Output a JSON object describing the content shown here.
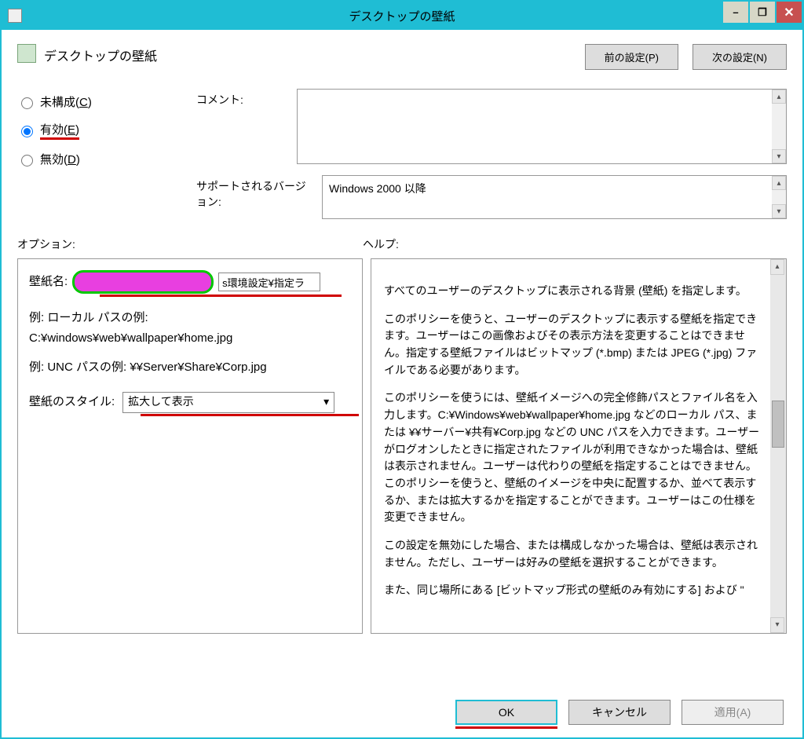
{
  "window": {
    "title": "デスクトップの壁紙",
    "min_label": "–",
    "max_label": "❐",
    "close_label": "✕"
  },
  "header": {
    "policy_name": "デスクトップの壁紙",
    "prev_btn": "前の設定(P)",
    "next_btn": "次の設定(N)"
  },
  "state": {
    "not_configured": {
      "label_head": "未構成(",
      "accel": "C",
      "label_tail": ")"
    },
    "enabled": {
      "label_head": "有効(",
      "accel": "E",
      "label_tail": ")"
    },
    "disabled": {
      "label_head": "無効(",
      "accel": "D",
      "label_tail": ")"
    },
    "selected": "enabled"
  },
  "form": {
    "comment_label": "コメント:",
    "supported_label": "サポートされるバージョン:",
    "supported_value": "Windows 2000 以降"
  },
  "sections": {
    "options_label": "オプション:",
    "help_label": "ヘルプ:"
  },
  "options": {
    "wallpaper_name_label": "壁紙名:",
    "wallpaper_name_value": "s環境設定¥指定ラ",
    "local_example_label": "例: ローカル パスの例:",
    "local_example_value": "C:¥windows¥web¥wallpaper¥home.jpg",
    "unc_example_label": "例: UNC パスの例: ¥¥Server¥Share¥Corp.jpg",
    "style_label": "壁紙のスタイル:",
    "style_value": "拡大して表示"
  },
  "help": {
    "p1": "すべてのユーザーのデスクトップに表示される背景 (壁紙) を指定します。",
    "p2": "このポリシーを使うと、ユーザーのデスクトップに表示する壁紙を指定できます。ユーザーはこの画像およびその表示方法を変更することはできません。指定する壁紙ファイルはビットマップ (*.bmp) または JPEG (*.jpg) ファイルである必要があります。",
    "p3": "このポリシーを使うには、壁紙イメージへの完全修飾パスとファイル名を入力します。C:¥Windows¥web¥wallpaper¥home.jpg などのローカル パス、または ¥¥サーバー¥共有¥Corp.jpg などの UNC パスを入力できます。ユーザーがログオンしたときに指定されたファイルが利用できなかった場合は、壁紙は表示されません。ユーザーは代わりの壁紙を指定することはできません。このポリシーを使うと、壁紙のイメージを中央に配置するか、並べて表示するか、または拡大するかを指定することができます。ユーザーはこの仕様を変更できません。",
    "p4": "この設定を無効にした場合、または構成しなかった場合は、壁紙は表示されません。ただし、ユーザーは好みの壁紙を選択することができます。",
    "p5": "また、同じ場所にある [ビットマップ形式の壁紙のみ有効にする] および \""
  },
  "actions": {
    "ok": "OK",
    "cancel": "キャンセル",
    "apply": "適用(A)"
  }
}
